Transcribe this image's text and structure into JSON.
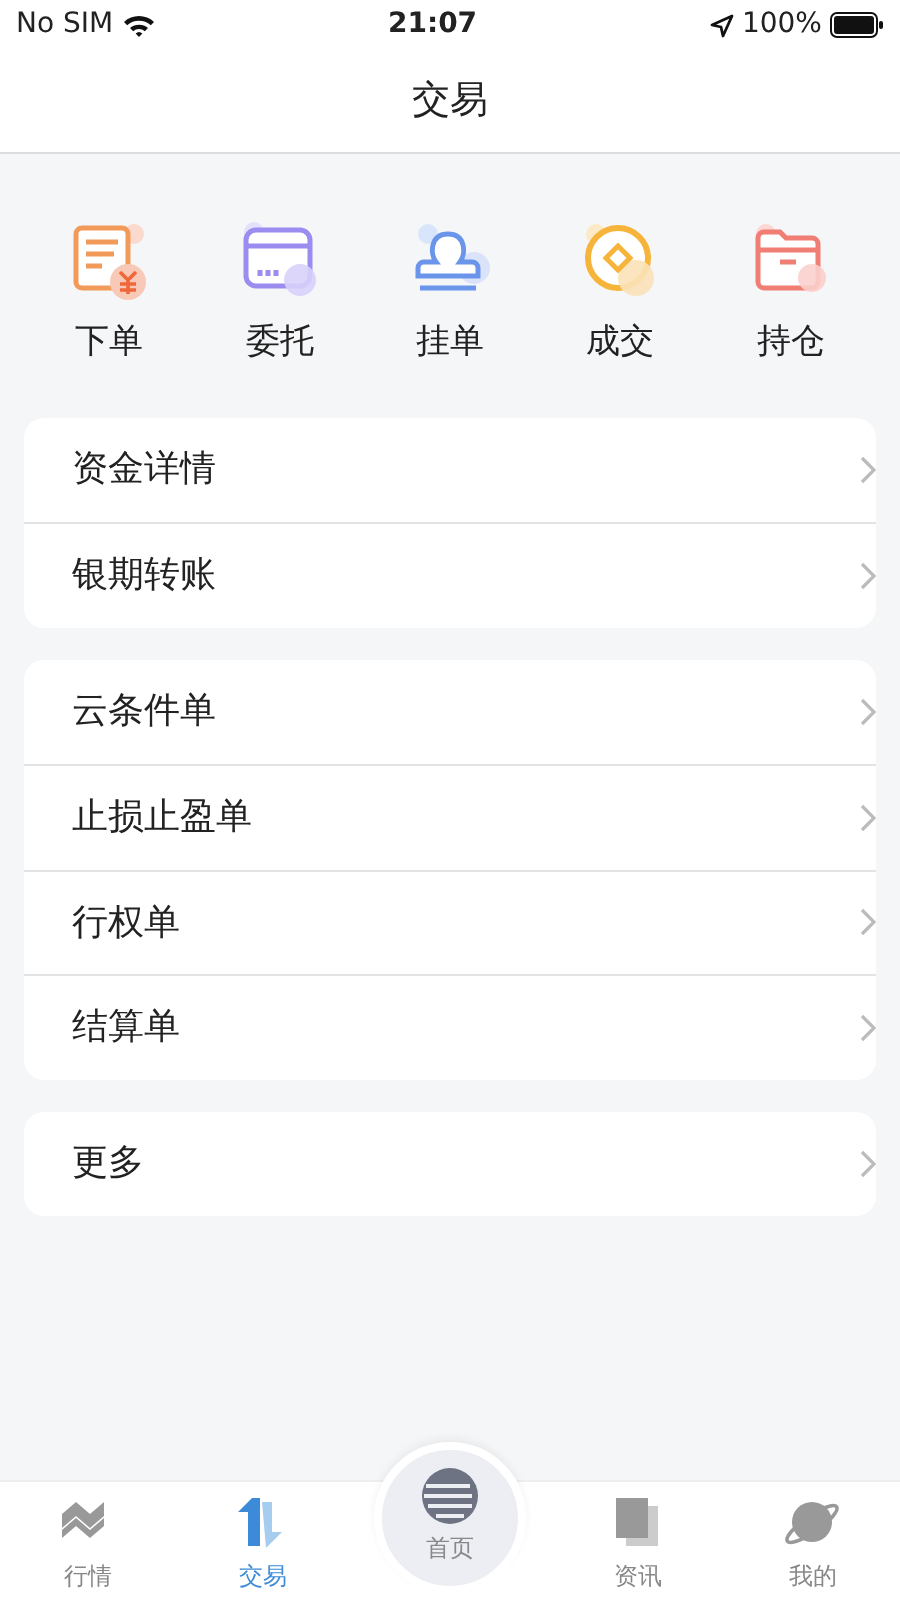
{
  "status_bar": {
    "carrier": "No SIM",
    "time": "21:07",
    "battery": "100%"
  },
  "nav_bar": {
    "title": "交易"
  },
  "quick_actions": [
    {
      "label": "下单",
      "kind": "order"
    },
    {
      "label": "委托",
      "kind": "entrust"
    },
    {
      "label": "挂单",
      "kind": "stamp"
    },
    {
      "label": "成交",
      "kind": "coin"
    },
    {
      "label": "持仓",
      "kind": "folder"
    }
  ],
  "menu_groups": [
    {
      "items": [
        {
          "label": "资金详情"
        },
        {
          "label": "银期转账"
        }
      ]
    },
    {
      "items": [
        {
          "label": "云条件单"
        },
        {
          "label": "止损止盈单"
        },
        {
          "label": "行权单"
        },
        {
          "label": "结算单"
        }
      ]
    },
    {
      "items": [
        {
          "label": "更多"
        }
      ]
    }
  ],
  "tab_bar": [
    {
      "label": "行情",
      "kind": "market",
      "selected": false
    },
    {
      "label": "交易",
      "kind": "trade",
      "selected": true
    },
    {
      "label": "首页",
      "kind": "home",
      "selected": false
    },
    {
      "label": "资讯",
      "kind": "news",
      "selected": false
    },
    {
      "label": "我的",
      "kind": "planet",
      "selected": false
    }
  ]
}
